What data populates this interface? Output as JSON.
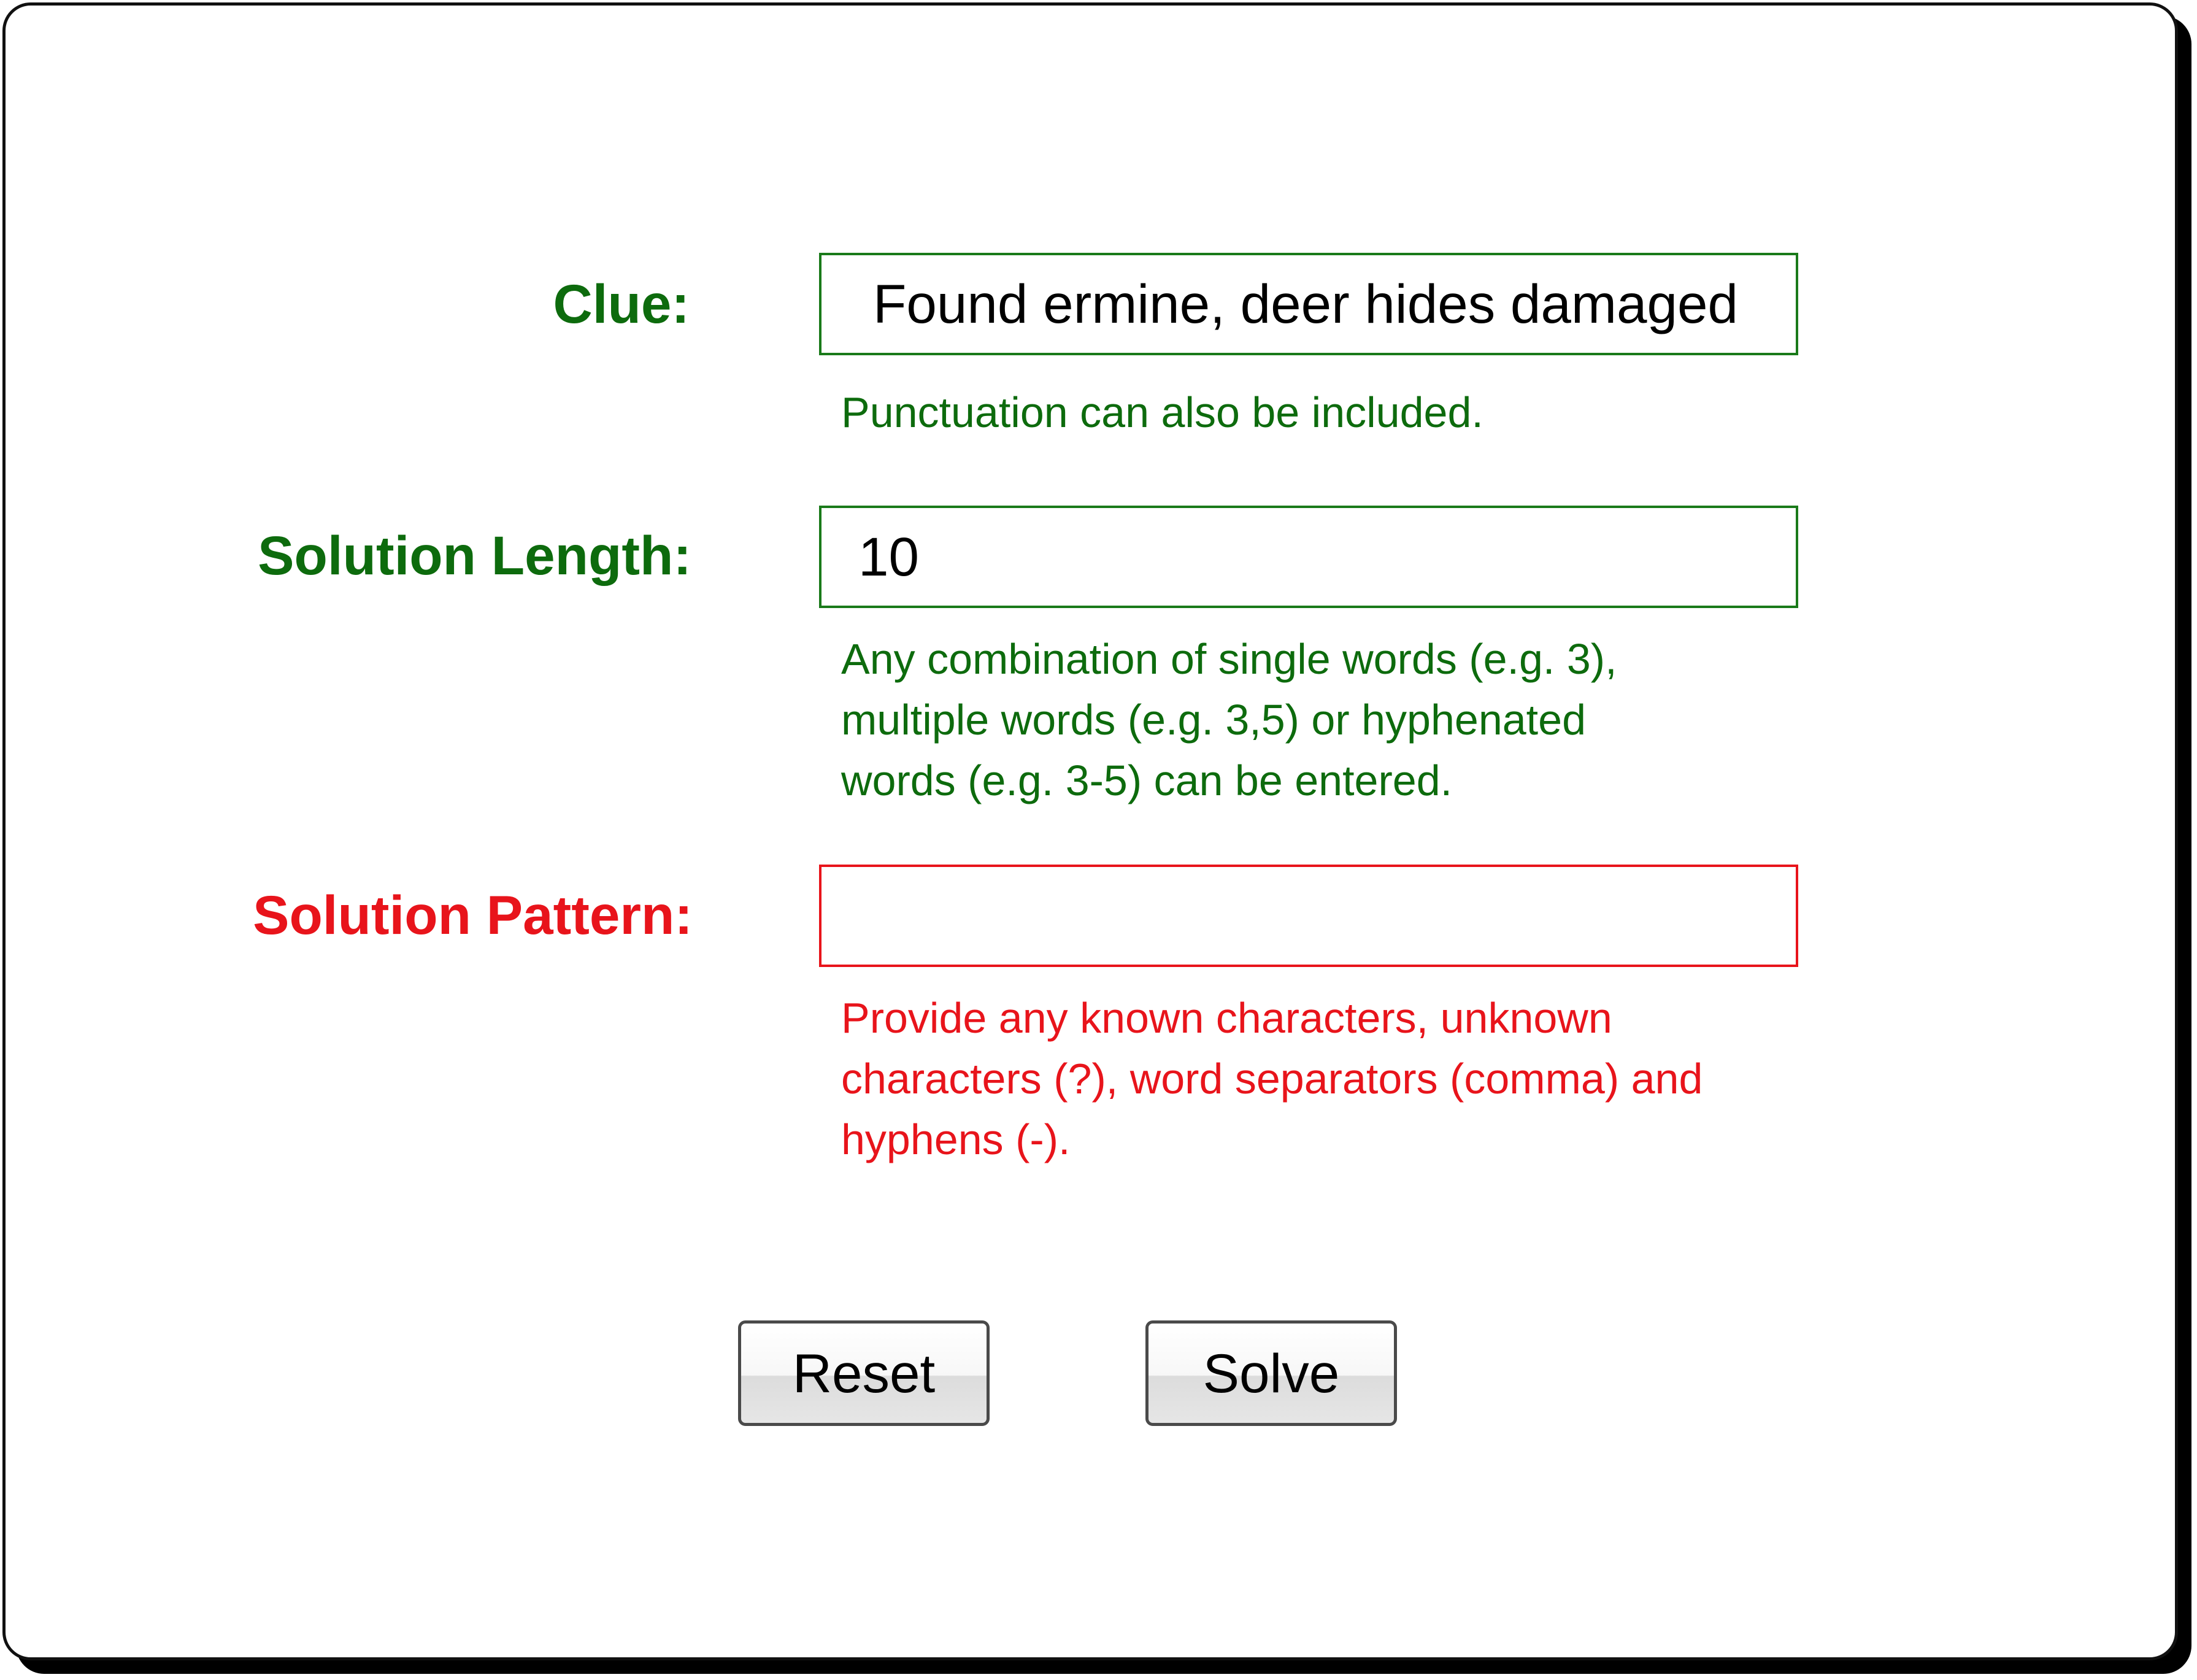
{
  "clue": {
    "label": "Clue:",
    "value": "Found ermine, deer hides damaged",
    "help": "Punctuation can also be included."
  },
  "length": {
    "label": "Solution Length:",
    "value": "10",
    "help_lines": [
      "Any combination of single words (e.g. 3),",
      "multiple words (e.g. 3,5) or hyphenated",
      "words (e.g. 3-5) can be entered."
    ]
  },
  "pattern": {
    "label": "Solution Pattern:",
    "value": "",
    "help_lines": [
      "Provide any known characters, unknown",
      "characters (?), word separators (comma) and",
      "hyphens (-)."
    ]
  },
  "buttons": {
    "reset": "Reset",
    "solve": "Solve"
  },
  "colors": {
    "valid": "#0d6b0d",
    "invalid": "#e8141b"
  }
}
